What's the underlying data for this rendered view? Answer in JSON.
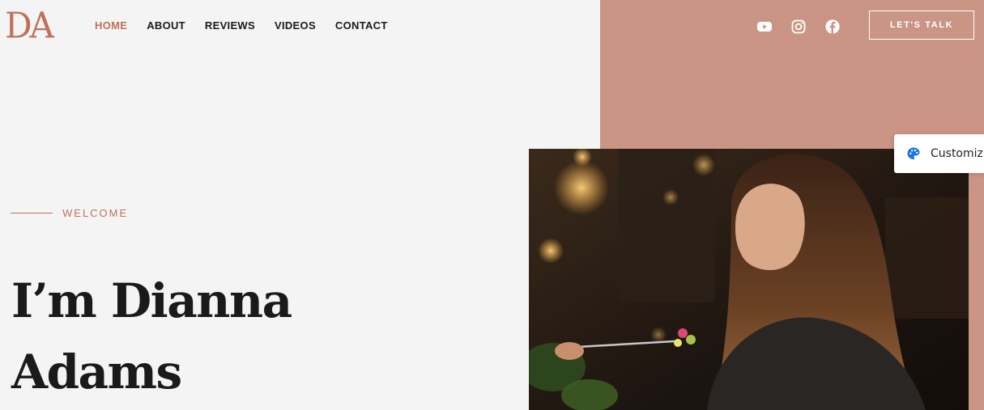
{
  "brand": {
    "logo_text": "DA"
  },
  "nav": {
    "items": [
      {
        "label": "HOME"
      },
      {
        "label": "ABOUT"
      },
      {
        "label": "REVIEWS"
      },
      {
        "label": "VIDEOS"
      },
      {
        "label": "CONTACT"
      }
    ],
    "active": "HOME"
  },
  "social": {
    "icons": [
      "youtube-icon",
      "instagram-icon",
      "facebook-icon"
    ]
  },
  "cta": {
    "label": "LET'S TALK"
  },
  "hero": {
    "eyebrow": "WELCOME",
    "headline_line1": "I’m Dianna",
    "headline_line2": "Adams"
  },
  "customize": {
    "label": "Customiz"
  },
  "colors": {
    "accent": "#c0705a",
    "panel": "#cb9585",
    "background": "#f4f4f4",
    "heading": "#1a1a1a"
  }
}
